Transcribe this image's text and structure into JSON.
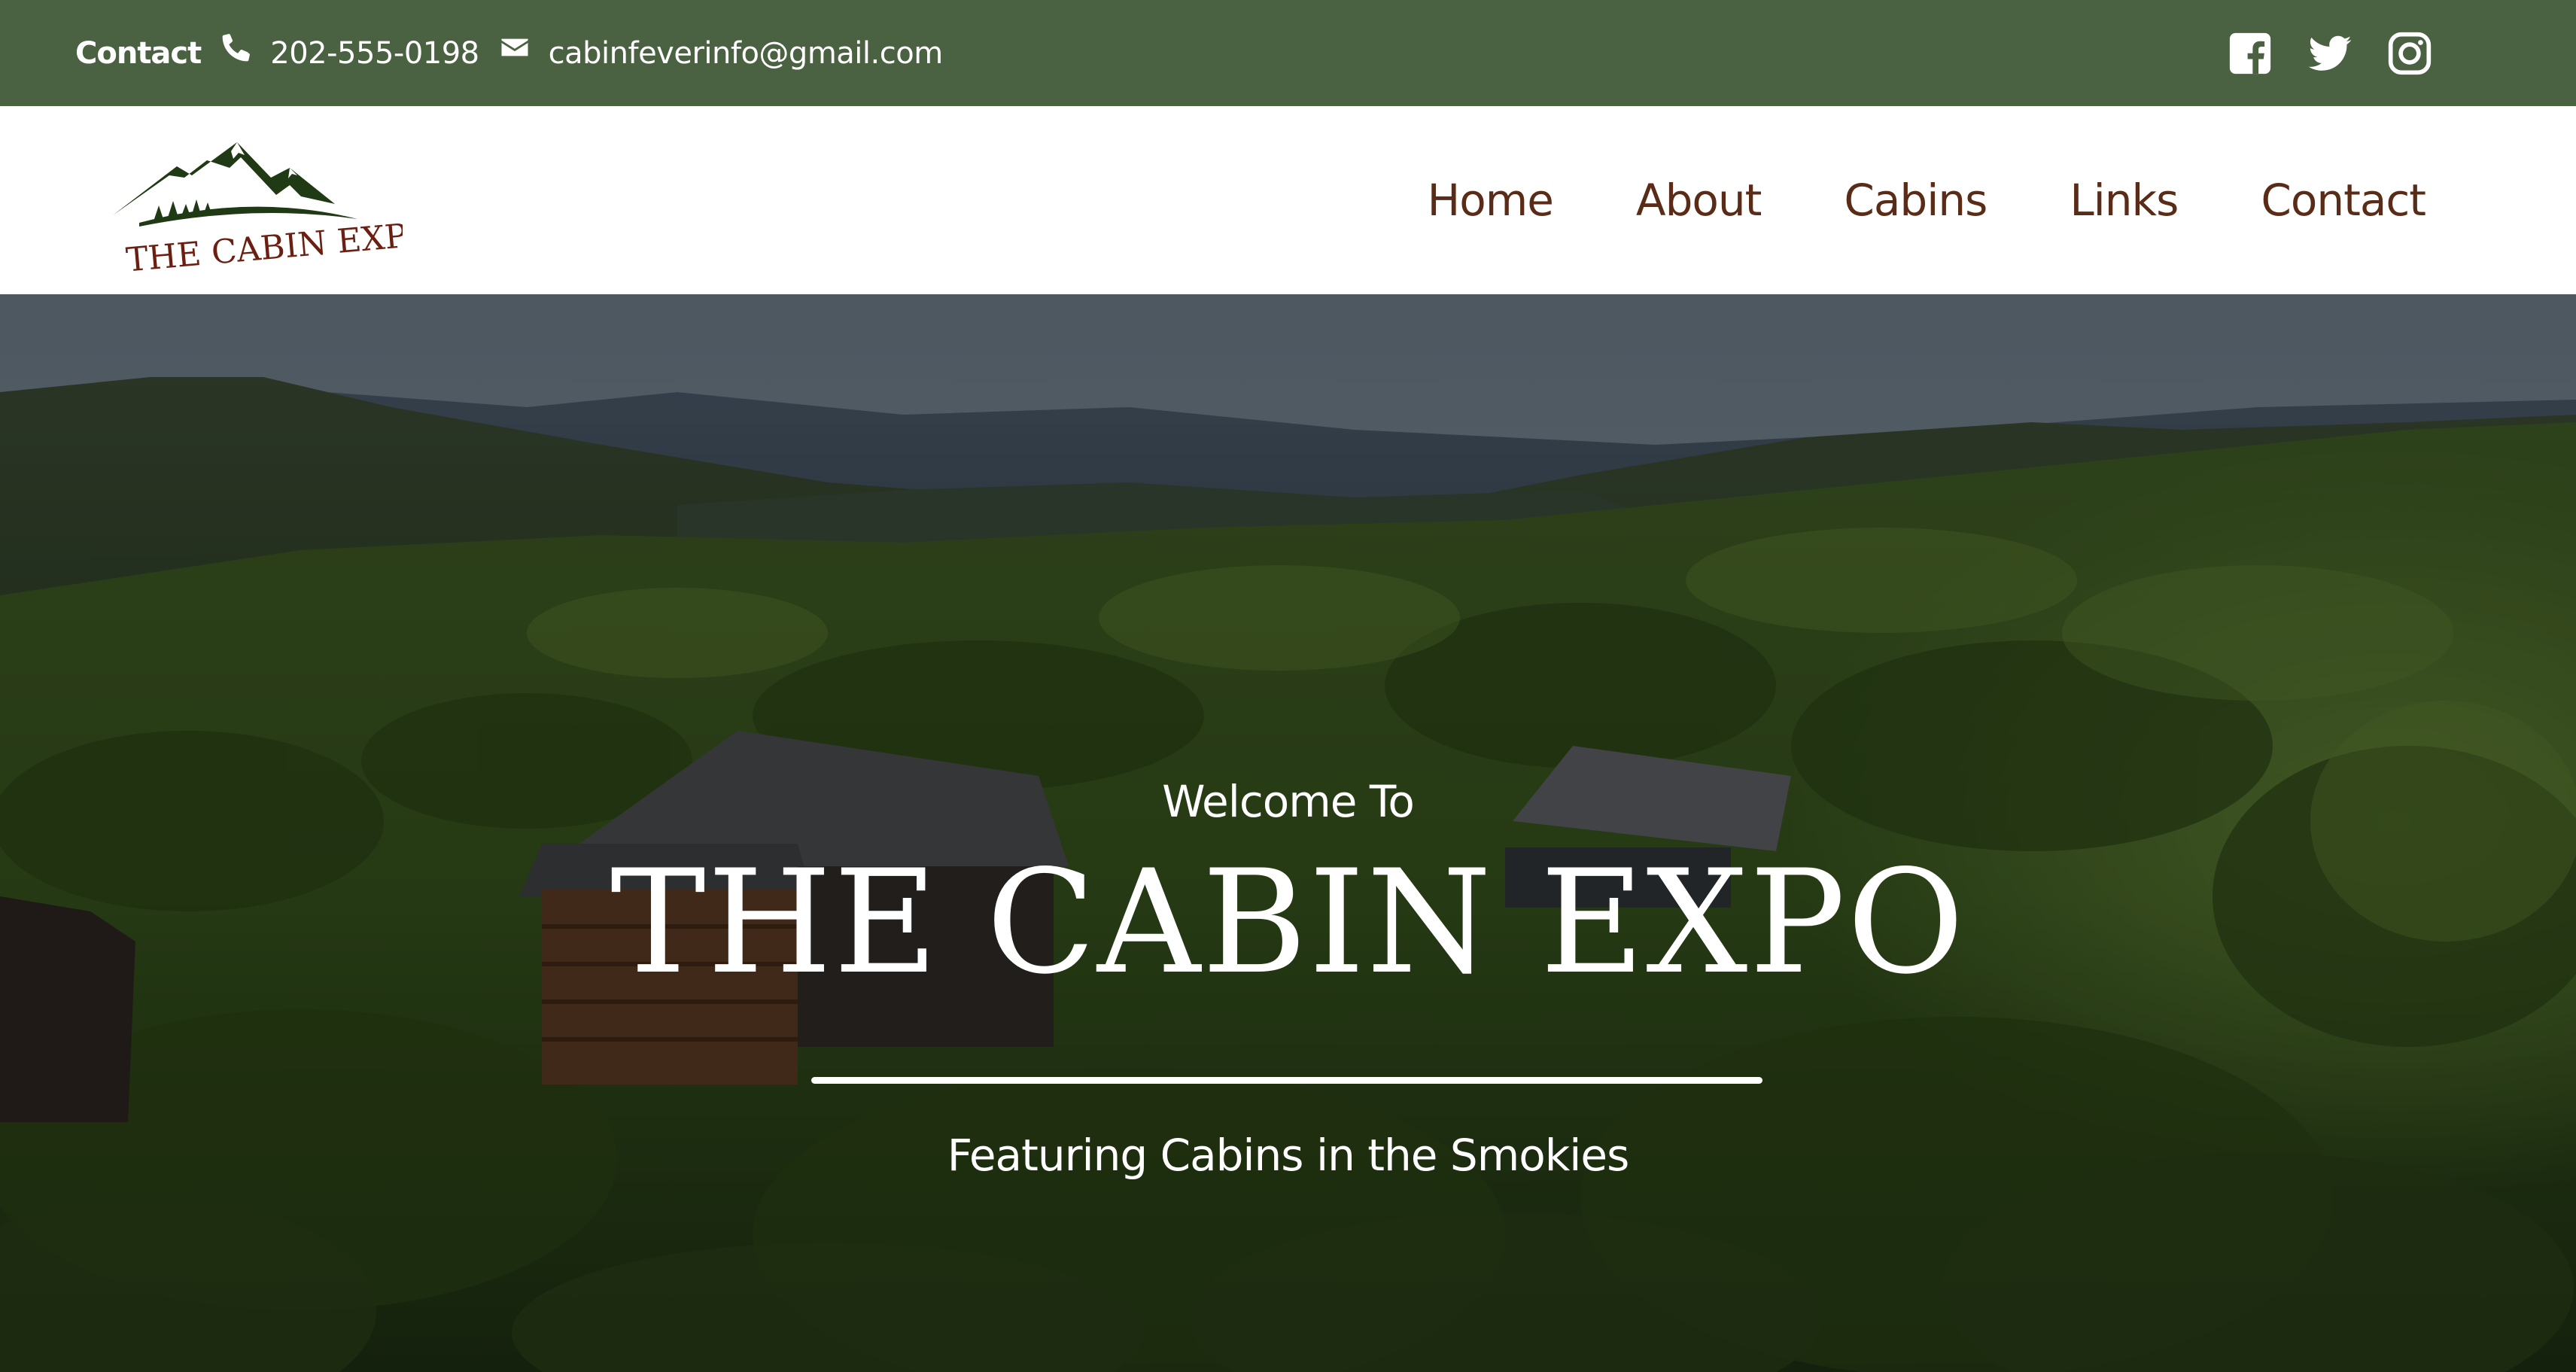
{
  "topbar": {
    "contact_label": "Contact",
    "phone": "202-555-0198",
    "email": "cabinfeverinfo@gmail.com",
    "phone_icon": "phone-icon",
    "email_icon": "envelope-icon",
    "social": [
      "facebook-icon",
      "twitter-icon",
      "instagram-icon"
    ],
    "background_color": "#4a6142"
  },
  "logo": {
    "text": "THE CABIN EXPO",
    "color": "#1f3a14",
    "text_color": "#6b1f10"
  },
  "nav": {
    "items": [
      "Home",
      "About",
      "Cabins",
      "Links",
      "Contact"
    ],
    "color": "#5a2b17"
  },
  "hero": {
    "welcome": "Welcome To",
    "title": "THE CABIN EXPO",
    "subtitle": "Featuring Cabins in the Smokies"
  }
}
